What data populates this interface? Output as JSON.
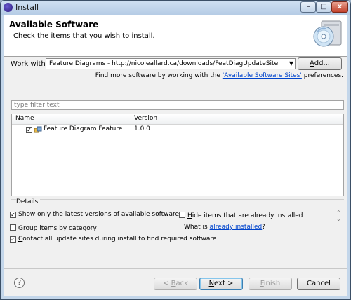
{
  "window": {
    "title": "Install",
    "min_label": "–",
    "max_label": "□",
    "close_label": "x"
  },
  "header": {
    "title": "Available Software",
    "subtitle": "Check the items that you wish to install."
  },
  "work_with": {
    "label_prefix": "",
    "label_mnemonic": "W",
    "label_rest": "ork with:",
    "value": "Feature Diagrams - http://nicoleallard.ca/downloads/FeatDiagUpdateSite",
    "add_mnemonic": "A",
    "add_rest": "dd...",
    "more_prefix": "Find more software by working with the ",
    "more_link": "'Available Software Sites'",
    "more_suffix": " preferences."
  },
  "filter": {
    "placeholder": "type filter text"
  },
  "tree": {
    "columns": [
      "Name",
      "Version"
    ],
    "rows": [
      {
        "name": "Feature Diagram Feature",
        "version": "1.0.0",
        "checked": true
      }
    ]
  },
  "details": {
    "label": "Details"
  },
  "options": {
    "latest": {
      "pre": "Show only the ",
      "mn": "l",
      "post": "atest versions of available software",
      "checked": true
    },
    "hide": {
      "pre": "",
      "mn": "H",
      "post": "ide items that are already installed",
      "checked": false
    },
    "group": {
      "pre": "",
      "mn": "G",
      "post": "roup items by category",
      "checked": false
    },
    "whatis_prefix": "What is ",
    "whatis_link": "already installed",
    "whatis_suffix": "?",
    "contact": {
      "pre": "",
      "mn": "C",
      "post": "ontact all update sites during install to find required software",
      "checked": true
    }
  },
  "buttons": {
    "back": {
      "pre": "< ",
      "mn": "B",
      "post": "ack"
    },
    "next": {
      "pre": "",
      "mn": "N",
      "post": "ext >"
    },
    "finish": {
      "pre": "",
      "mn": "F",
      "post": "inish"
    },
    "cancel": "Cancel",
    "help_glyph": "?"
  },
  "colors": {
    "link": "#0044cc",
    "accent": "#3c7fb1"
  }
}
